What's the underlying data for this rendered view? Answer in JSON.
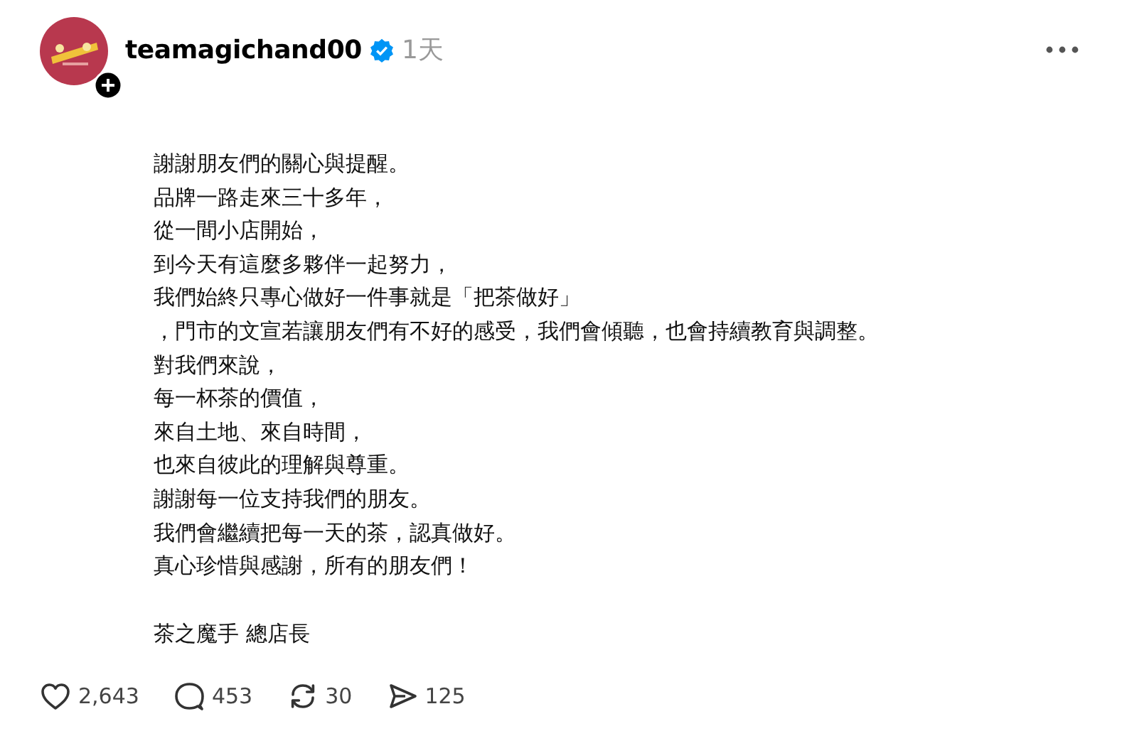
{
  "author": {
    "username": "teamagichand00",
    "verified": true,
    "time": "1天"
  },
  "body_lines": [
    "謝謝朋友們的關心與提醒。",
    "品牌一路走來三十多年，",
    "從一間小店開始，",
    "到今天有這麼多夥伴一起努力，",
    "我們始終只專心做好一件事就是「把茶做好」",
    "，門市的文宣若讓朋友們有不好的感受，我們會傾聽，也會持續教育與調整。",
    "對我們來說，",
    "每一杯茶的價值，",
    "來自土地、來自時間，",
    "也來自彼此的理解與尊重。",
    "謝謝每一位支持我們的朋友。",
    "我們會繼續把每一天的茶，認真做好。",
    "真心珍惜與感謝，所有的朋友們！"
  ],
  "signature": "茶之魔手 總店長",
  "actions": [
    {
      "kind": "like",
      "count": "2,643"
    },
    {
      "kind": "reply",
      "count": "453"
    },
    {
      "kind": "repost",
      "count": "30"
    },
    {
      "kind": "share",
      "count": "125"
    }
  ]
}
